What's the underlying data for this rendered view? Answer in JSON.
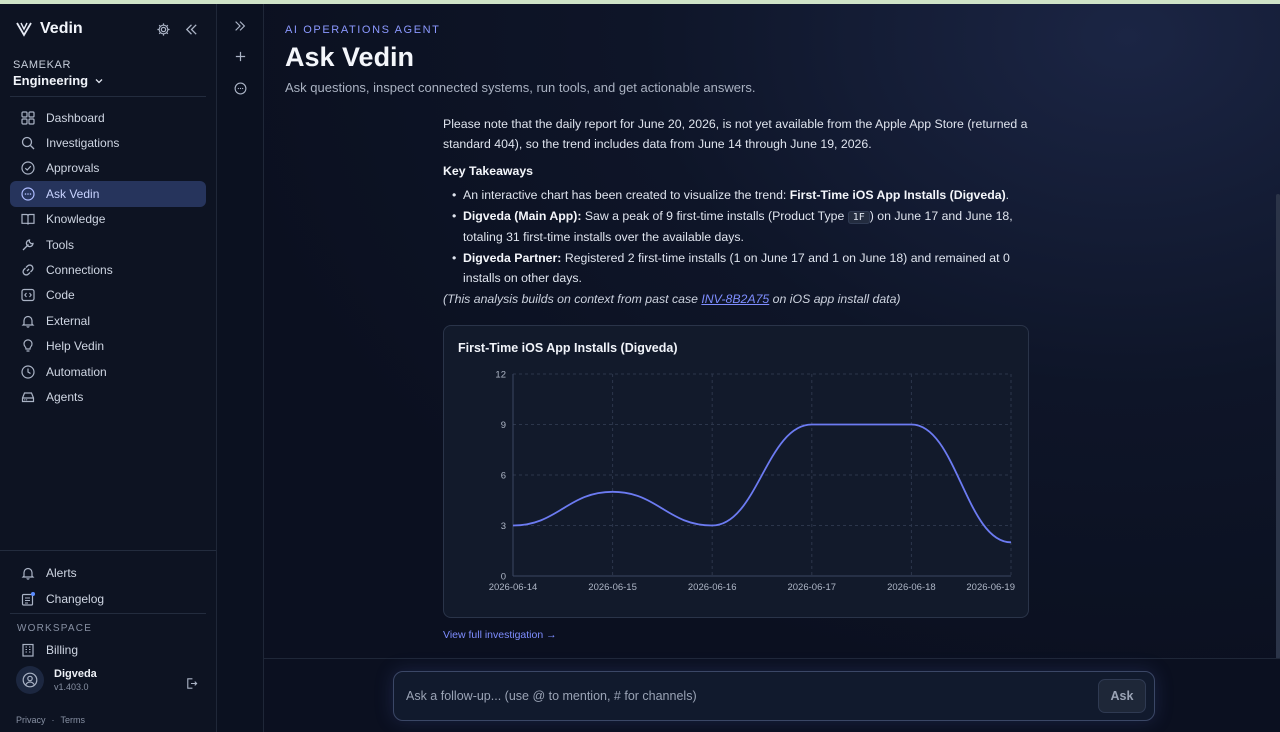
{
  "sidebar": {
    "brand": "Vedin",
    "org_label": "SAMEKAR",
    "org_name": "Engineering",
    "items": [
      {
        "label": "Dashboard",
        "icon": "grid-icon"
      },
      {
        "label": "Investigations",
        "icon": "search-icon"
      },
      {
        "label": "Approvals",
        "icon": "check-circle-icon"
      },
      {
        "label": "Ask Vedin",
        "icon": "chat-icon",
        "active": true
      },
      {
        "label": "Knowledge",
        "icon": "book-icon"
      },
      {
        "label": "Tools",
        "icon": "wrench-icon"
      },
      {
        "label": "Connections",
        "icon": "link-icon"
      },
      {
        "label": "Code",
        "icon": "code-icon"
      },
      {
        "label": "External",
        "icon": "bell-icon"
      },
      {
        "label": "Help Vedin",
        "icon": "lightbulb-icon"
      },
      {
        "label": "Automation",
        "icon": "clock-icon"
      },
      {
        "label": "Agents",
        "icon": "server-icon"
      }
    ],
    "bottom": {
      "alerts": "Alerts",
      "changelog": "Changelog",
      "workspace_label": "WORKSPACE",
      "billing": "Billing"
    },
    "user": {
      "name": "Digveda",
      "version": "v1.403.0"
    },
    "legal": {
      "privacy": "Privacy",
      "sep": "·",
      "terms": "Terms"
    }
  },
  "header": {
    "eyebrow": "AI OPERATIONS AGENT",
    "title": "Ask Vedin",
    "subtitle": "Ask questions, inspect connected systems, run tools, and get actionable answers."
  },
  "message": {
    "intro": "Please note that the daily report for June 20, 2026, is not yet available from the Apple App Store (returned a standard 404), so the trend includes data from June 14 through June 19, 2026.",
    "heading": "Key Takeaways",
    "b1_pre": "An interactive chart has been created to visualize the trend: ",
    "b1_bold": "First-Time iOS App Installs (Digveda)",
    "b1_post": ".",
    "b2_bold": "Digveda (Main App):",
    "b2_pre": " Saw a peak of 9 first-time installs (Product Type ",
    "b2_code": "1F",
    "b2_post": ") on June 17 and June 18, totaling 31 first-time installs over the available days.",
    "b3_bold": "Digveda Partner:",
    "b3_post": " Registered 2 first-time installs (1 on June 17 and 1 on June 18) and remained at 0 installs on other days.",
    "note_pre": "(This analysis builds on context from past case ",
    "note_link": "INV-8B2A75",
    "note_post": " on iOS app install data)",
    "view_link": "View full investigation →"
  },
  "chart_data": {
    "type": "line",
    "title": "First-Time iOS App Installs (Digveda)",
    "x": [
      "2026-06-14",
      "2026-06-15",
      "2026-06-16",
      "2026-06-17",
      "2026-06-18",
      "2026-06-19"
    ],
    "series": [
      {
        "values": [
          3,
          5,
          3,
          9,
          9,
          2
        ],
        "color": "#6c7bf2"
      }
    ],
    "yticks": [
      0,
      3,
      6,
      9,
      12
    ],
    "ylim": [
      0,
      12
    ],
    "grid": true
  },
  "composer": {
    "placeholder": "Ask a follow-up... (use @ to mention, # for channels)",
    "ask_label": "Ask"
  },
  "colors": {
    "accent": "#8b98ff",
    "active_nav": "#26345c",
    "line": "#6c7bf2"
  }
}
